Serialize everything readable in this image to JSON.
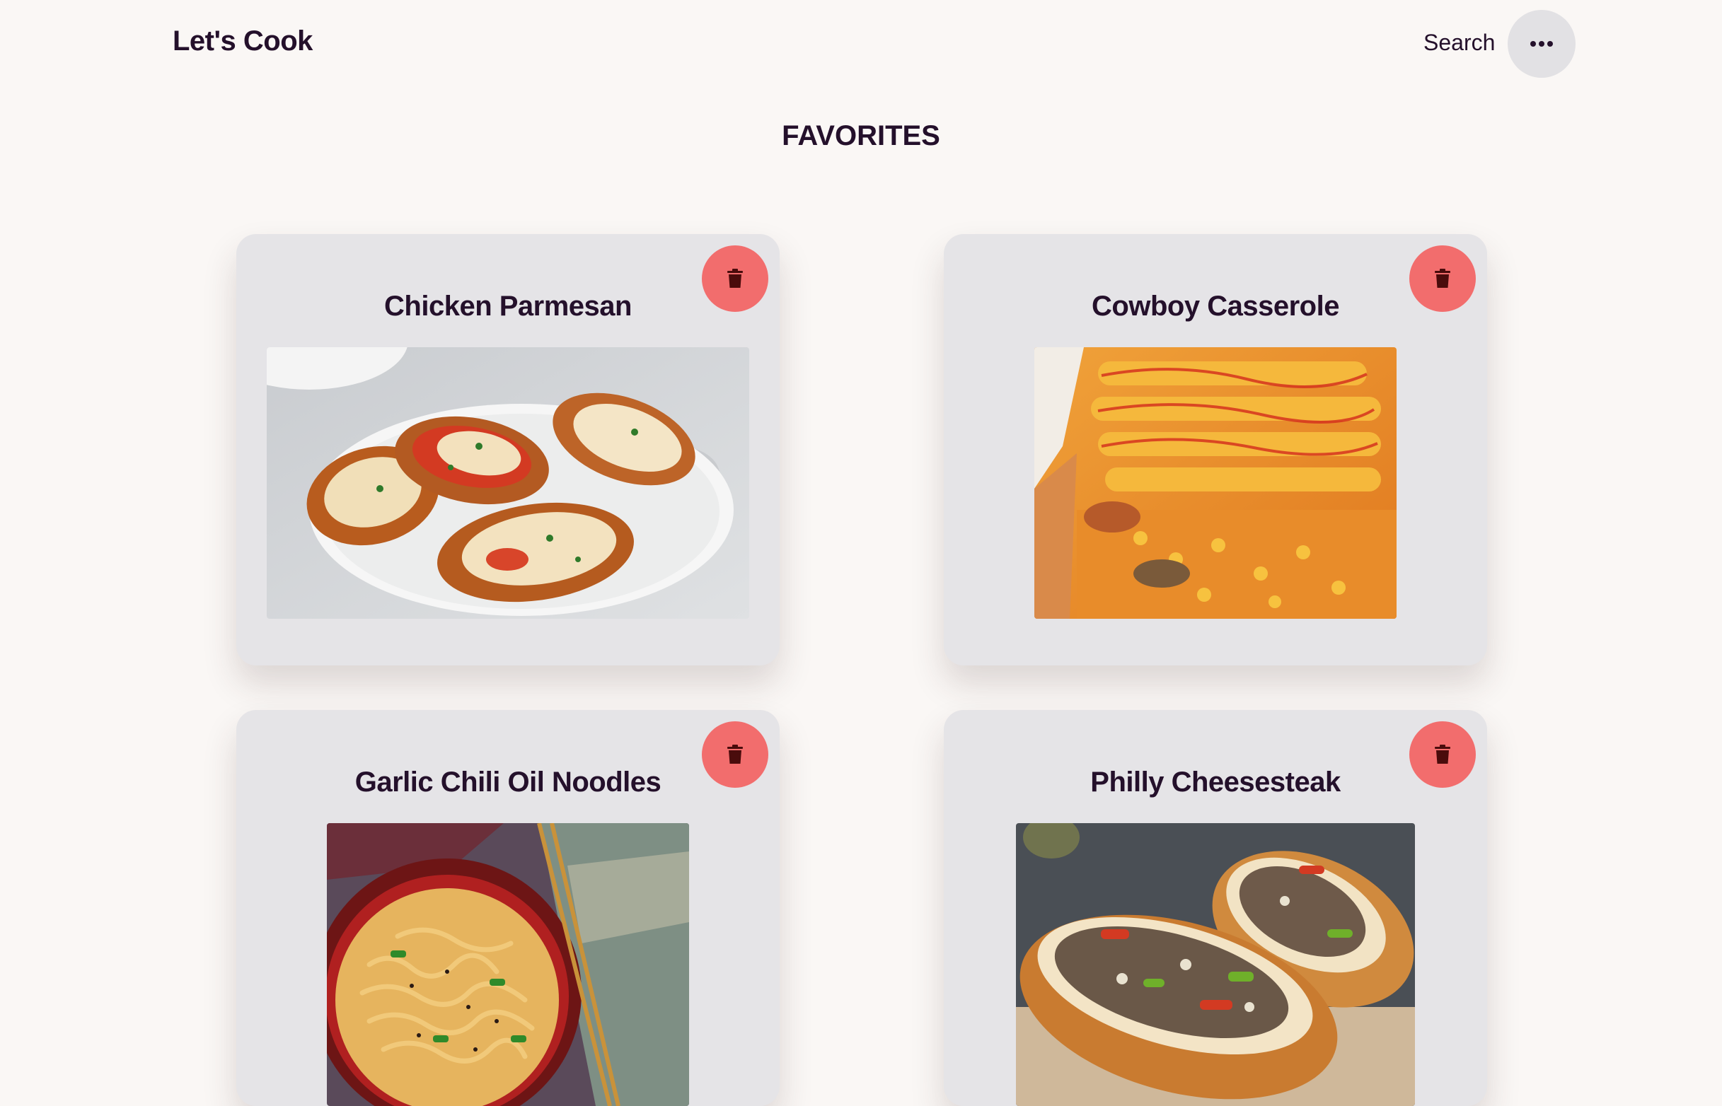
{
  "app": {
    "brand": "Let's Cook",
    "search_label": "Search"
  },
  "icons": {
    "menu": "ellipsis-icon",
    "delete": "trash-icon"
  },
  "colors": {
    "background": "#faf7f5",
    "card": "#e5e4e7",
    "delete_button": "#f26d6d",
    "text": "#24102b"
  },
  "page": {
    "title": "FAVORITES"
  },
  "recipes": [
    {
      "title": "Chicken Parmesan"
    },
    {
      "title": "Cowboy Casserole"
    },
    {
      "title": "Garlic Chili Oil Noodles"
    },
    {
      "title": "Philly Cheesesteak"
    }
  ]
}
